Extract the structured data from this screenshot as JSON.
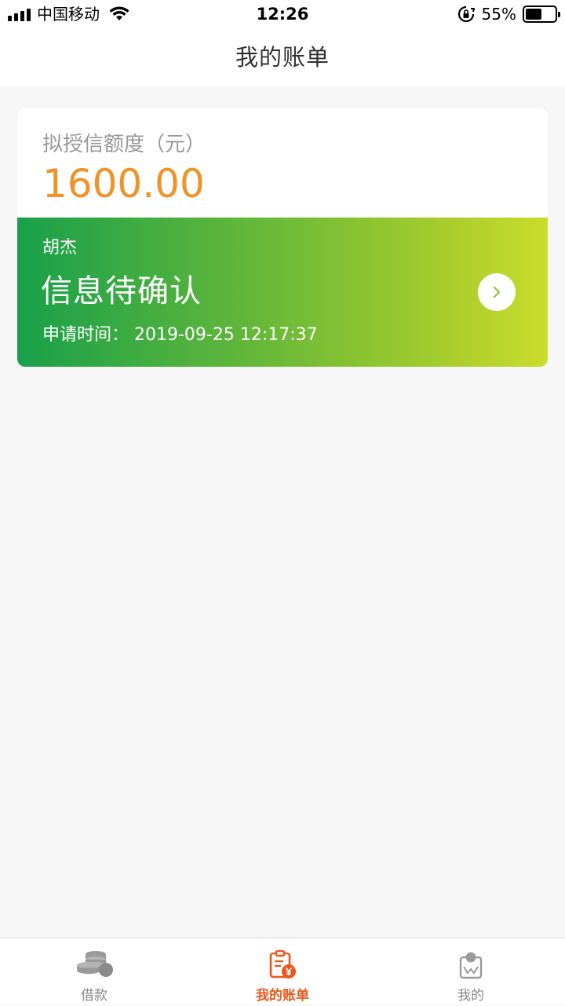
{
  "status_bar": {
    "carrier": "中国移动",
    "time": "12:26",
    "battery_percent": "55%",
    "battery_level": 0.55
  },
  "nav": {
    "title": "我的账单"
  },
  "bill_card": {
    "quota_label": "拟授信额度（元）",
    "quota_value": "1600.00",
    "applicant": "胡杰",
    "status": "信息待确认",
    "apply_time": "申请时间：  2019-09-25 12:17:37"
  },
  "tabs": [
    {
      "label": "借款",
      "icon": "coins-icon",
      "active": false
    },
    {
      "label": "我的账单",
      "icon": "bill-icon",
      "active": true
    },
    {
      "label": "我的",
      "icon": "profile-icon",
      "active": false
    }
  ],
  "colors": {
    "accent": "#e9581e",
    "amount": "#f09224",
    "gradient_start": "#19a04a",
    "gradient_end": "#cbdc2a",
    "inactive_tab": "#888888"
  }
}
